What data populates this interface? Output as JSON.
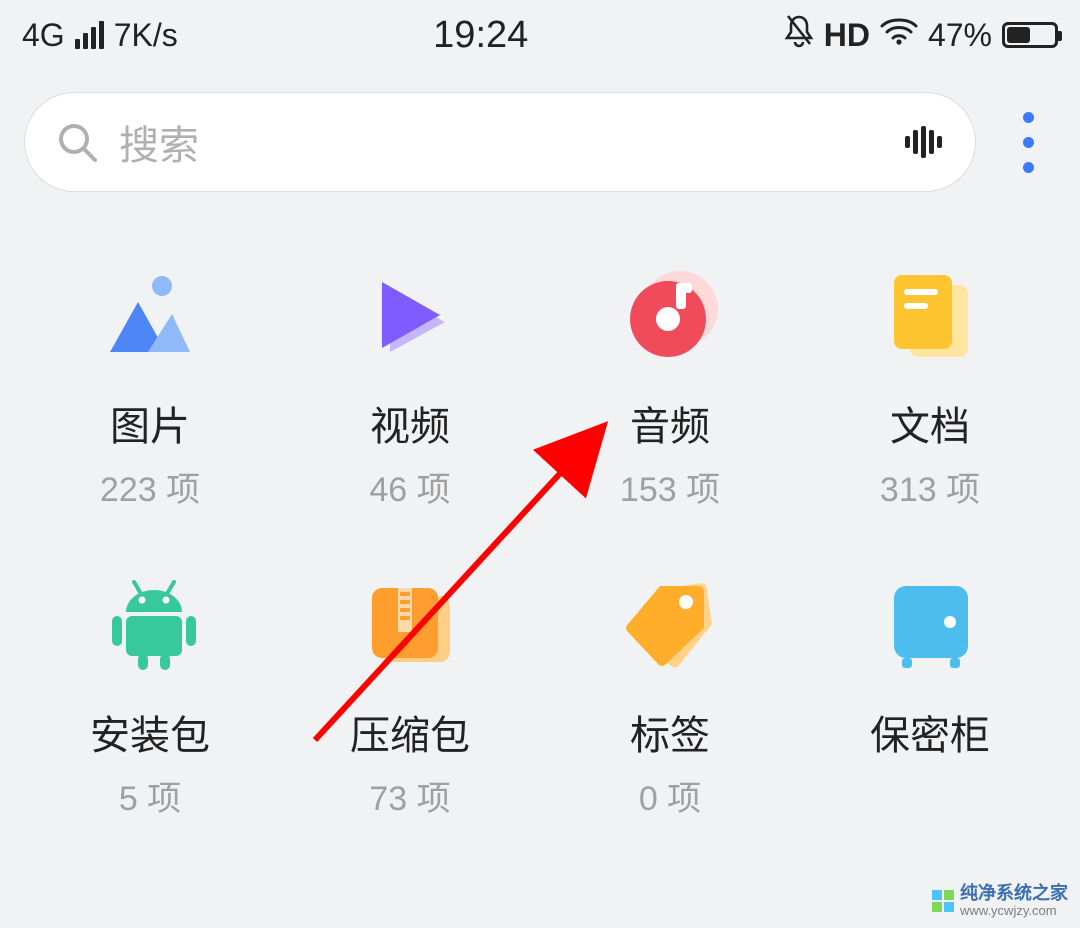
{
  "status": {
    "network": "4G",
    "speed": "7K/s",
    "time": "19:24",
    "hd": "HD",
    "battery_pct": "47%"
  },
  "search": {
    "placeholder": "搜索"
  },
  "categories": [
    {
      "label": "图片",
      "count": "223 项",
      "icon": "image-icon"
    },
    {
      "label": "视频",
      "count": "46 项",
      "icon": "video-icon"
    },
    {
      "label": "音频",
      "count": "153 项",
      "icon": "audio-icon"
    },
    {
      "label": "文档",
      "count": "313 项",
      "icon": "document-icon"
    },
    {
      "label": "安装包",
      "count": "5 项",
      "icon": "apk-icon"
    },
    {
      "label": "压缩包",
      "count": "73 项",
      "icon": "archive-icon"
    },
    {
      "label": "标签",
      "count": "0 项",
      "icon": "tag-icon"
    },
    {
      "label": "保密柜",
      "count": "",
      "icon": "safe-icon"
    }
  ],
  "watermark": {
    "title": "纯净系统之家",
    "url": "www.ycwjzy.com"
  }
}
